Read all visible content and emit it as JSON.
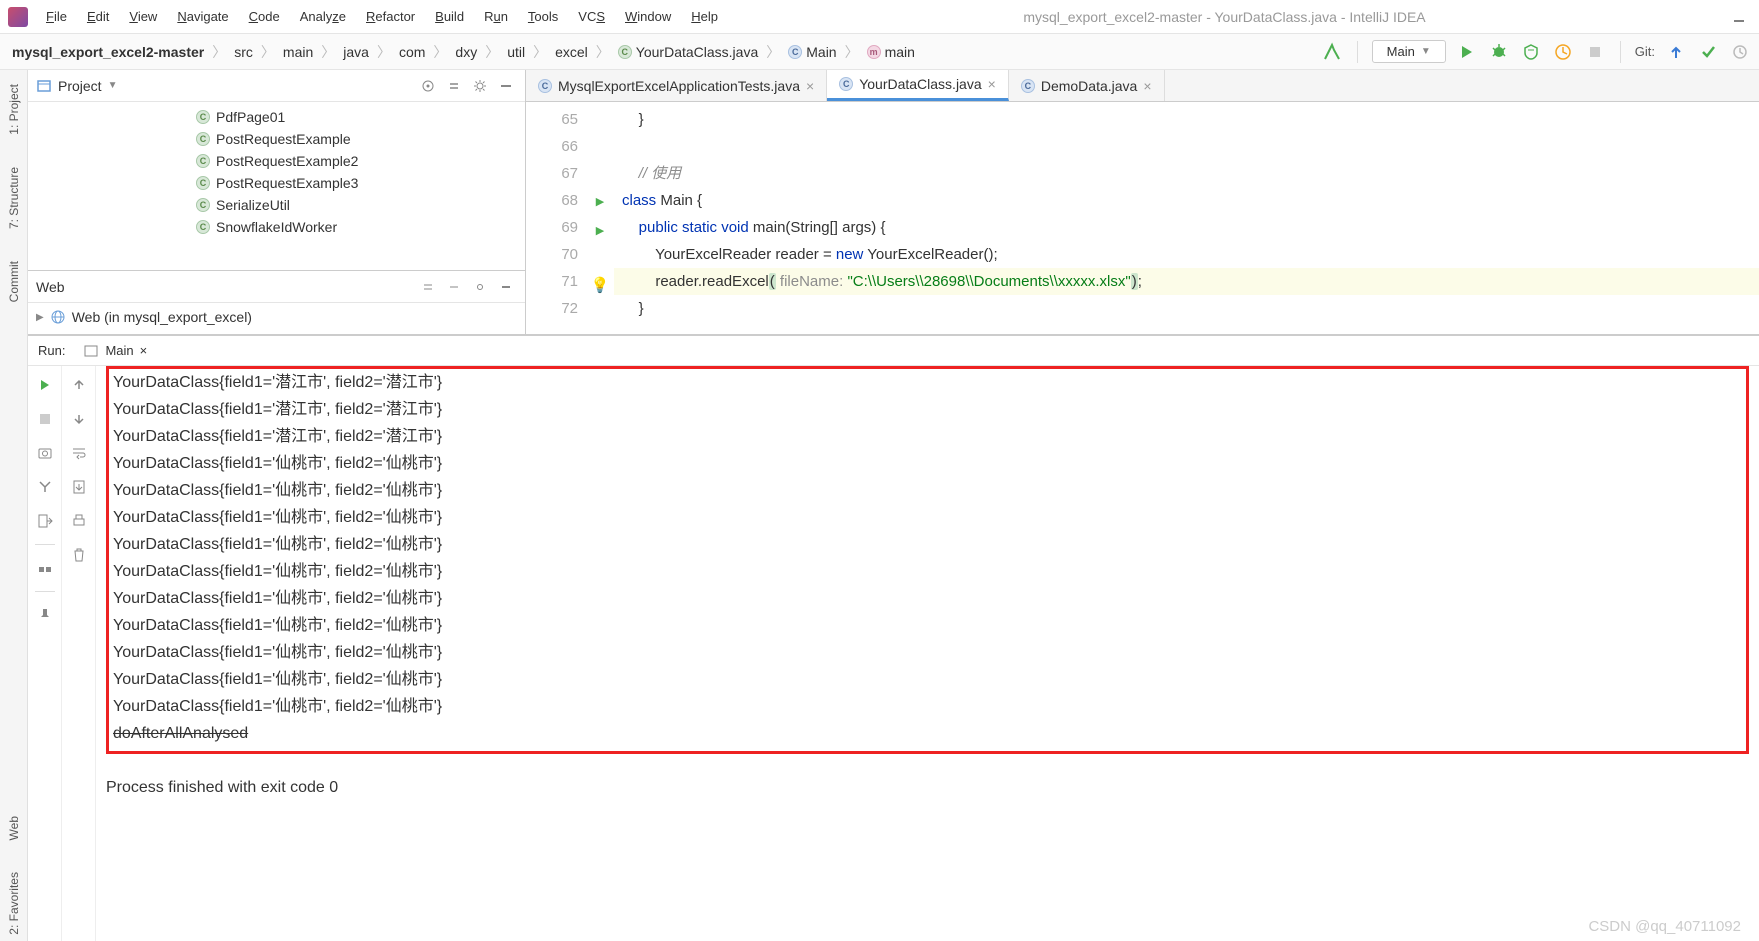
{
  "title": "mysql_export_excel2-master - YourDataClass.java - IntelliJ IDEA",
  "menu": {
    "file": "File",
    "edit": "Edit",
    "view": "View",
    "navigate": "Navigate",
    "code": "Code",
    "analyze": "Analyze",
    "refactor": "Refactor",
    "build": "Build",
    "run": "Run",
    "tools": "Tools",
    "vcs": "VCS",
    "window": "Window",
    "help": "Help"
  },
  "breadcrumb": {
    "items": [
      "mysql_export_excel2-master",
      "src",
      "main",
      "java",
      "com",
      "dxy",
      "util",
      "excel",
      "YourDataClass.java",
      "Main",
      "main"
    ]
  },
  "run_config": "Main",
  "git_label": "Git:",
  "project_panel": {
    "title": "Project",
    "items": [
      "PdfPage01",
      "PostRequestExample",
      "PostRequestExample2",
      "PostRequestExample3",
      "SerializeUtil",
      "SnowflakeIdWorker"
    ]
  },
  "web_panel": {
    "title": "Web",
    "item": "Web (in mysql_export_excel)"
  },
  "tabs": [
    {
      "label": "MysqlExportExcelApplicationTests.java",
      "active": false
    },
    {
      "label": "YourDataClass.java",
      "active": true
    },
    {
      "label": "DemoData.java",
      "active": false
    }
  ],
  "code": {
    "lines": [
      {
        "n": 65,
        "text": "    }"
      },
      {
        "n": 66,
        "text": ""
      },
      {
        "n": 67,
        "text": "    // 使用",
        "comment": true
      },
      {
        "n": 68,
        "text": "class Main {",
        "run": true,
        "fold": true
      },
      {
        "n": 69,
        "text": "    public static void main(String[] args) {",
        "run": true,
        "fold": true
      },
      {
        "n": 70,
        "text": "        YourExcelReader reader = new YourExcelReader();"
      },
      {
        "n": 71,
        "text": "        reader.readExcel( fileName: \"C:\\\\Users\\\\28698\\\\Documents\\\\xxxxx.xlsx\");",
        "hl": true,
        "bulb": true
      },
      {
        "n": 72,
        "text": "    }",
        "fold": true
      }
    ]
  },
  "run": {
    "label": "Run:",
    "config": "Main",
    "output": [
      "YourDataClass{field1='潜江市', field2='潜江市'}",
      "YourDataClass{field1='潜江市', field2='潜江市'}",
      "YourDataClass{field1='潜江市', field2='潜江市'}",
      "YourDataClass{field1='仙桃市', field2='仙桃市'}",
      "YourDataClass{field1='仙桃市', field2='仙桃市'}",
      "YourDataClass{field1='仙桃市', field2='仙桃市'}",
      "YourDataClass{field1='仙桃市', field2='仙桃市'}",
      "YourDataClass{field1='仙桃市', field2='仙桃市'}",
      "YourDataClass{field1='仙桃市', field2='仙桃市'}",
      "YourDataClass{field1='仙桃市', field2='仙桃市'}",
      "YourDataClass{field1='仙桃市', field2='仙桃市'}",
      "YourDataClass{field1='仙桃市', field2='仙桃市'}",
      "YourDataClass{field1='仙桃市', field2='仙桃市'}",
      "doAfterAllAnalysed"
    ],
    "exit": "Process finished with exit code 0"
  },
  "rail": {
    "project": "1: Project",
    "structure": "7: Structure",
    "commit": "Commit",
    "web": "Web",
    "favorites": "2: Favorites"
  },
  "watermark": "CSDN @qq_40711092"
}
